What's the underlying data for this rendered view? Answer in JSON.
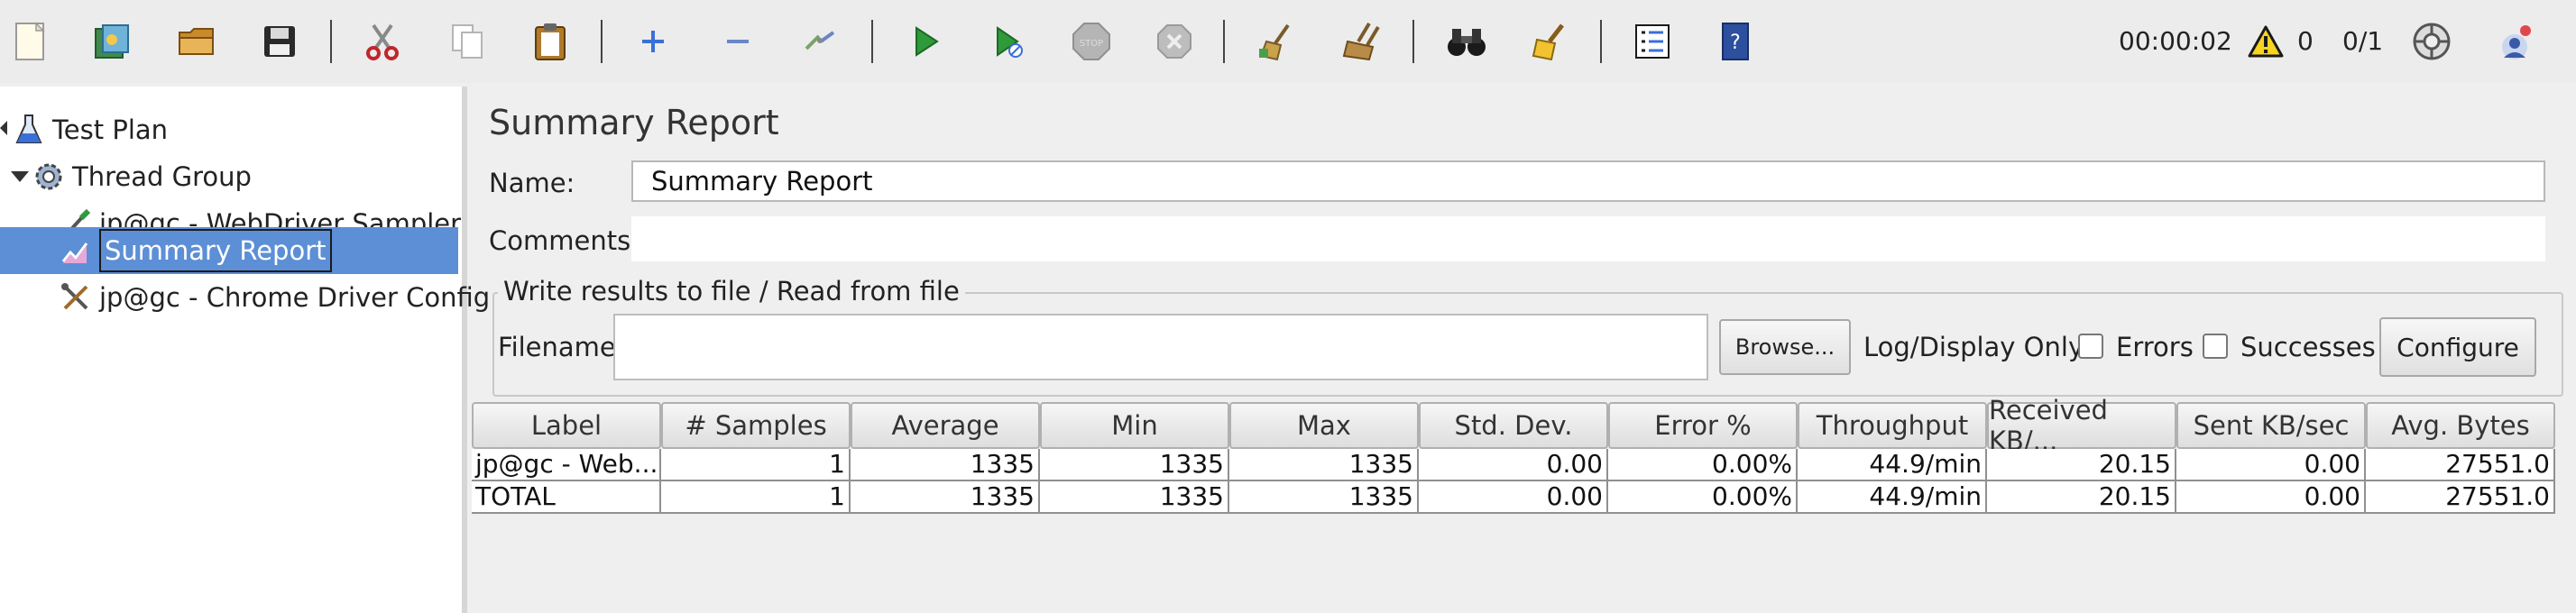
{
  "toolbar": {
    "elapsed_time": "00:00:02",
    "warning_count": "0",
    "threads_status": "0/1",
    "buttons": [
      "new-file",
      "templates",
      "open",
      "save",
      "cut",
      "copy",
      "paste",
      "expand",
      "collapse",
      "toggle",
      "start",
      "start-no-pauses",
      "stop",
      "shutdown",
      "clear",
      "clear-all",
      "search",
      "reset-search",
      "function-helper",
      "help"
    ]
  },
  "tree": {
    "items": [
      {
        "label": "Test Plan",
        "icon": "flask-icon"
      },
      {
        "label": "Thread Group",
        "icon": "gear-icon"
      },
      {
        "label": "jp@gc - WebDriver Sampler",
        "icon": "pipette-icon"
      },
      {
        "label": "Summary Report",
        "icon": "report-icon",
        "selected": true
      },
      {
        "label": "jp@gc - Chrome Driver Config",
        "icon": "tools-icon"
      }
    ]
  },
  "panel": {
    "title": "Summary Report",
    "name_label": "Name:",
    "name_value": "Summary Report",
    "comments_label": "Comments:",
    "comments_value": "",
    "file_section_legend": "Write results to file / Read from file",
    "filename_label": "Filename",
    "filename_value": "",
    "browse_label": "Browse...",
    "log_display_label": "Log/Display Only:",
    "errors_label": "Errors",
    "successes_label": "Successes",
    "configure_label": "Configure"
  },
  "table": {
    "columns": [
      "Label",
      "# Samples",
      "Average",
      "Min",
      "Max",
      "Std. Dev.",
      "Error %",
      "Throughput",
      "Received KB/...",
      "Sent KB/sec",
      "Avg. Bytes"
    ],
    "rows": [
      [
        "jp@gc - Web...",
        "1",
        "1335",
        "1335",
        "1335",
        "0.00",
        "0.00%",
        "44.9/min",
        "20.15",
        "0.00",
        "27551.0"
      ],
      [
        "TOTAL",
        "1",
        "1335",
        "1335",
        "1335",
        "0.00",
        "0.00%",
        "44.9/min",
        "20.15",
        "0.00",
        "27551.0"
      ]
    ]
  }
}
